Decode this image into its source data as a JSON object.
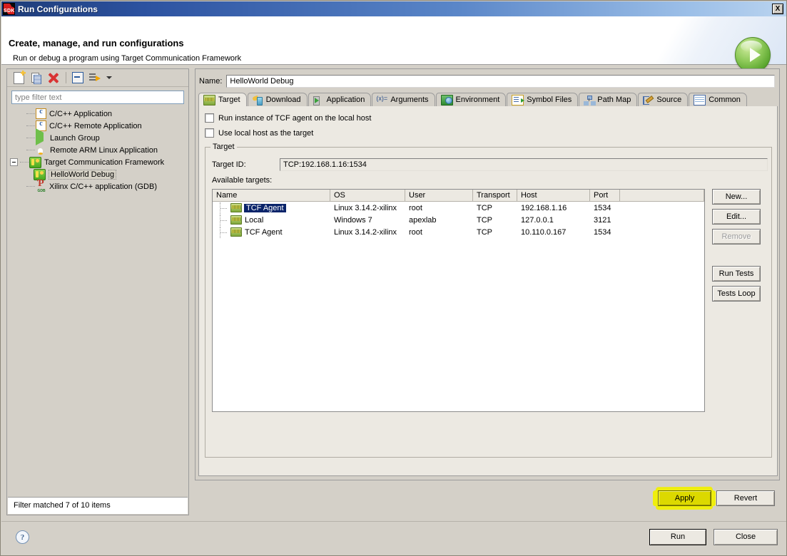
{
  "window": {
    "title": "Run Configurations",
    "icon": "sdk-logo-icon",
    "close_label": "X"
  },
  "banner": {
    "title": "Create, manage, and run configurations",
    "subtitle": "Run or debug a program using Target Communication Framework",
    "run_icon": "run-play-orb-icon"
  },
  "left_panel": {
    "toolbar": [
      {
        "name": "new-configuration-button",
        "icon": "new-document-icon"
      },
      {
        "name": "duplicate-configuration-button",
        "icon": "copy-document-icon"
      },
      {
        "name": "delete-configuration-button",
        "icon": "red-x-delete-icon"
      },
      {
        "name": "collapse-all-button",
        "icon": "collapse-all-icon"
      },
      {
        "name": "filter-button",
        "icon": "filter-arrow-icon"
      },
      {
        "name": "filter-menu-button",
        "icon": "chevron-down-icon"
      }
    ],
    "filter_placeholder": "type filter text",
    "filter_value": "",
    "tree": [
      {
        "label": "C/C++ Application",
        "icon": "c-file-icon",
        "level": 0,
        "twisty": "none",
        "selected": false
      },
      {
        "label": "C/C++ Remote Application",
        "icon": "c-file-icon",
        "level": 0,
        "twisty": "none",
        "selected": false
      },
      {
        "label": "Launch Group",
        "icon": "green-play-icon",
        "level": 0,
        "twisty": "none",
        "selected": false
      },
      {
        "label": "Remote ARM Linux Application",
        "icon": "linux-penguin-icon",
        "level": 0,
        "twisty": "none",
        "selected": false
      },
      {
        "label": "Target Communication Framework",
        "icon": "tcf-icon",
        "level": 0,
        "twisty": "expanded",
        "selected": false
      },
      {
        "label": "HelloWorld Debug",
        "icon": "tcf-icon",
        "level": 1,
        "twisty": "none",
        "selected": true
      },
      {
        "label": "Xilinx C/C++ application (GDB)",
        "icon": "gdb-icon",
        "level": 0,
        "twisty": "none",
        "selected": false
      }
    ],
    "status": "Filter matched 7 of 10 items"
  },
  "right_panel": {
    "name_label": "Name:",
    "name_value": "HelloWorld Debug",
    "tabs": [
      {
        "label": "Target",
        "icon": "target-chip-icon",
        "active": true
      },
      {
        "label": "Download",
        "icon": "download-icon",
        "active": false
      },
      {
        "label": "Application",
        "icon": "application-icon",
        "active": false
      },
      {
        "label": "Arguments",
        "icon": "arguments-icon",
        "active": false
      },
      {
        "label": "Environment",
        "icon": "environment-icon",
        "active": false
      },
      {
        "label": "Symbol Files",
        "icon": "symbol-files-icon",
        "active": false
      },
      {
        "label": "Path Map",
        "icon": "path-map-icon",
        "active": false
      },
      {
        "label": "Source",
        "icon": "source-icon",
        "active": false
      },
      {
        "label": "Common",
        "icon": "common-icon",
        "active": false
      }
    ],
    "checkboxes": [
      {
        "label": "Run instance of TCF agent on the local host",
        "checked": false
      },
      {
        "label": "Use local host as the target",
        "checked": false
      }
    ],
    "group": {
      "legend": "Target",
      "target_id_label": "Target ID:",
      "target_id_value": "TCP:192.168.1.16:1534",
      "available_label": "Available targets:",
      "table": {
        "columns": [
          "Name",
          "OS",
          "User",
          "Transport",
          "Host",
          "Port",
          ""
        ],
        "rows": [
          {
            "name": "TCF Agent",
            "os": "Linux 3.14.2-xilinx",
            "user": "root",
            "transport": "TCP",
            "host": "192.168.1.16",
            "port": "1534",
            "selected": true
          },
          {
            "name": "Local",
            "os": "Windows 7",
            "user": "apexlab",
            "transport": "TCP",
            "host": "127.0.0.1",
            "port": "3121",
            "selected": false
          },
          {
            "name": "TCF Agent",
            "os": "Linux 3.14.2-xilinx",
            "user": "root",
            "transport": "TCP",
            "host": "10.110.0.167",
            "port": "1534",
            "selected": false
          }
        ]
      },
      "side_buttons": [
        {
          "label": "New...",
          "enabled": true
        },
        {
          "label": "Edit...",
          "enabled": true
        },
        {
          "label": "Remove",
          "enabled": false
        },
        {
          "label": "Run Tests",
          "enabled": true
        },
        {
          "label": "Tests Loop",
          "enabled": true
        }
      ]
    },
    "apply_label": "Apply",
    "revert_label": "Revert",
    "apply_highlight_color": "#efee0e"
  },
  "footer": {
    "help_glyph": "?",
    "run_label": "Run",
    "close_label": "Close"
  }
}
